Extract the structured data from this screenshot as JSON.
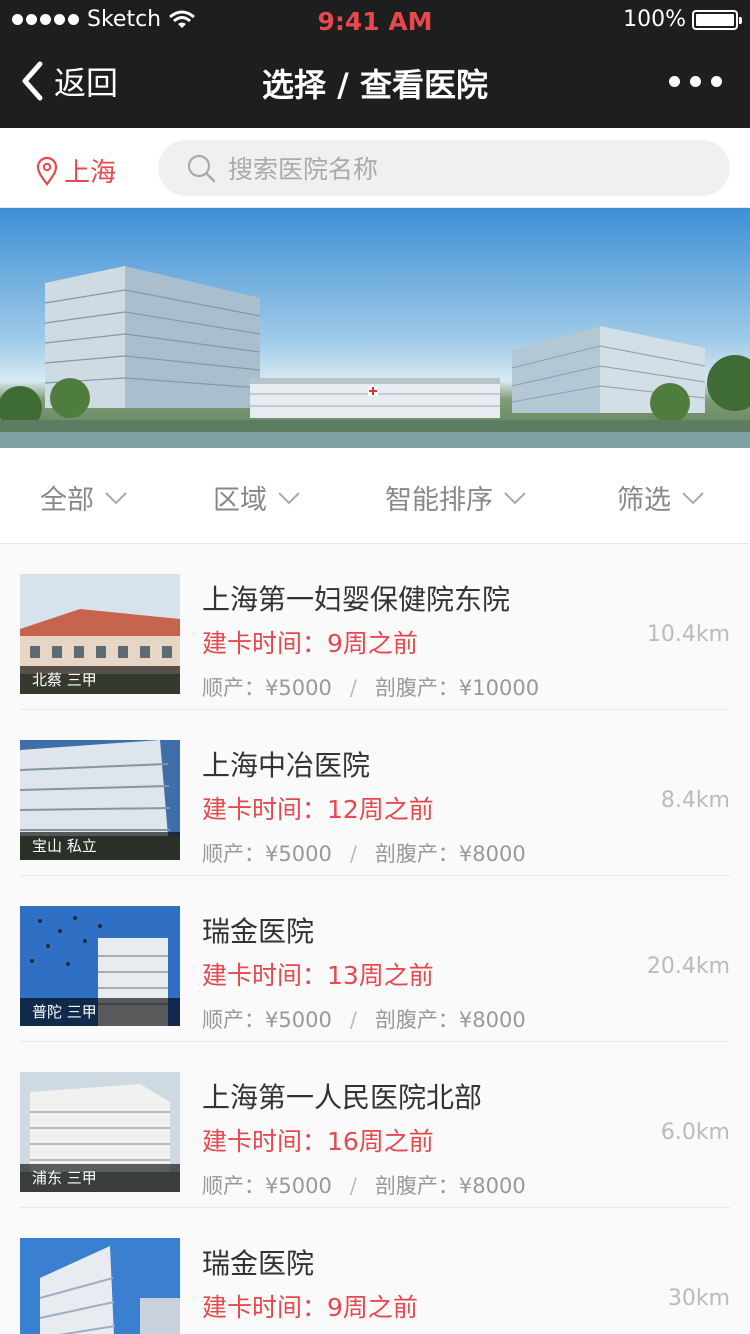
{
  "status_bar": {
    "carrier": "Sketch",
    "time": "9:41 AM",
    "battery": "100%"
  },
  "nav": {
    "back_label": "返回",
    "title": "选择 / 查看医院"
  },
  "location": {
    "city": "上海"
  },
  "search": {
    "placeholder": "搜索医院名称"
  },
  "filters": [
    "全部",
    "区域",
    "智能排序",
    "筛选"
  ],
  "hospitals": [
    {
      "name": "上海第一妇婴保健院东院",
      "tag": "北蔡  三甲",
      "time": "建卡时间：9周之前",
      "natural": "顺产：¥5000",
      "csection": "剖腹产：¥10000",
      "distance": "10.4km"
    },
    {
      "name": "上海中冶医院",
      "tag": "宝山  私立",
      "time": "建卡时间：12周之前",
      "natural": "顺产：¥5000",
      "csection": "剖腹产：¥8000",
      "distance": "8.4km"
    },
    {
      "name": "瑞金医院",
      "tag": "普陀  三甲",
      "time": "建卡时间：13周之前",
      "natural": "顺产：¥5000",
      "csection": "剖腹产：¥8000",
      "distance": "20.4km"
    },
    {
      "name": "上海第一人民医院北部",
      "tag": "浦东  三甲",
      "time": "建卡时间：16周之前",
      "natural": "顺产：¥5000",
      "csection": "剖腹产：¥8000",
      "distance": "6.0km"
    },
    {
      "name": "瑞金医院",
      "tag": "",
      "time": "建卡时间：9周之前",
      "natural": "",
      "csection": "",
      "distance": "30km"
    }
  ],
  "colors": {
    "accent": "#e8484d",
    "topbar": "#1e1e1e"
  },
  "separator": "/"
}
